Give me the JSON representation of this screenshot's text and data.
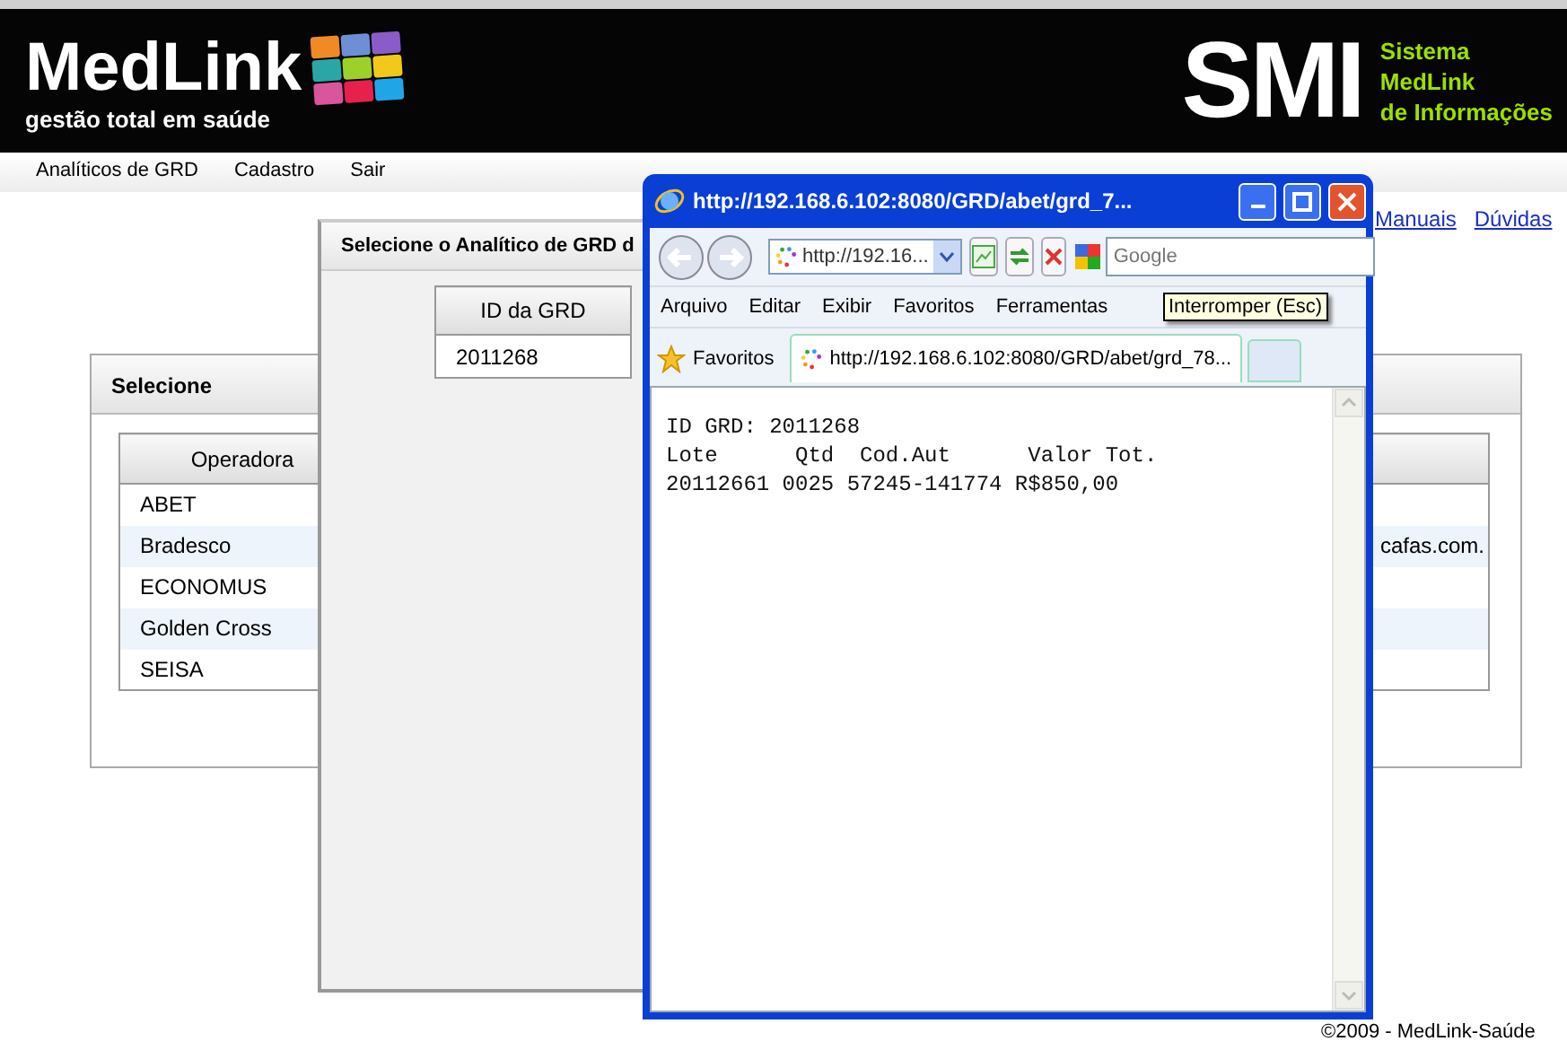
{
  "header": {
    "logo": "MedLink",
    "tagline": "gestão total em saúde",
    "brand": "SMI",
    "brand_lines": [
      "Sistema",
      "MedLink",
      "de Informações"
    ]
  },
  "menu": [
    "Analíticos de GRD",
    "Cadastro",
    "Sair"
  ],
  "links": [
    "Manuais",
    "Dúvidas"
  ],
  "select_panel": {
    "title": "Selecione",
    "columns": [
      "Operadora"
    ],
    "rows": [
      {
        "operadora": "ABET",
        "column_2": ""
      },
      {
        "operadora": "Bradesco",
        "column_2": "cafas.com."
      },
      {
        "operadora": "ECONOMUS",
        "column_2": ""
      },
      {
        "operadora": "Golden Cross",
        "column_2": ""
      },
      {
        "operadora": "SEISA",
        "column_2": ""
      }
    ]
  },
  "dialog": {
    "title": "Selecione o Analítico de GRD d",
    "columns": [
      "ID da GRD"
    ],
    "rows": [
      [
        "2011268"
      ]
    ]
  },
  "browser": {
    "title": "http://192.168.6.102:8080/GRD/abet/grd_7...",
    "address": "http://192.16...",
    "search_placeholder": "Google",
    "menu": [
      "Arquivo",
      "Editar",
      "Exibir",
      "Favoritos",
      "Ferramentas"
    ],
    "tooltip": "Interromper (Esc)",
    "favorites": "Favoritos",
    "tab": "http://192.168.6.102:8080/GRD/abet/grd_78...",
    "content": [
      "ID GRD: 2011268",
      "Lote      Qtd  Cod.Aut      Valor Tot.",
      "20112661 0025 57245-141774 R$850,00"
    ]
  },
  "footer": "©2009 - MedLink-Saúde"
}
